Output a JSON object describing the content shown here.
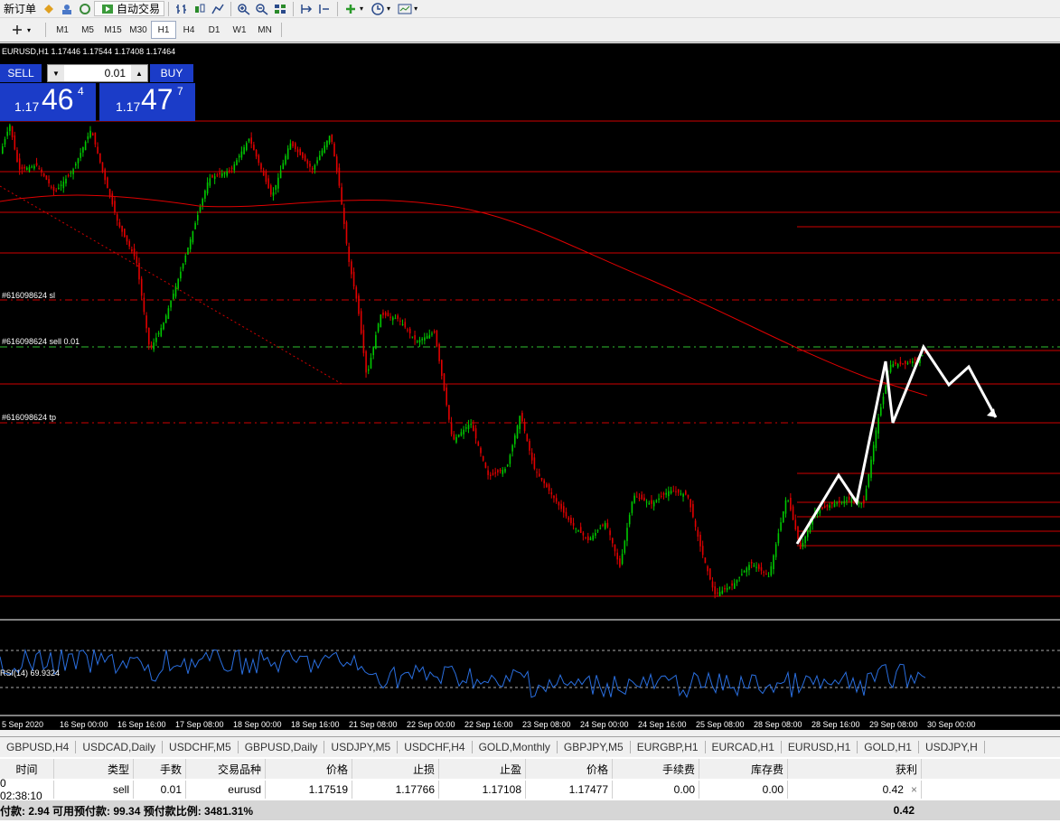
{
  "toolbar": {
    "new_order": "新订单",
    "auto_trading": "自动交易",
    "timeframes": [
      "M1",
      "M5",
      "M15",
      "M30",
      "H1",
      "H4",
      "D1",
      "W1",
      "MN"
    ],
    "active_timeframe": "H1"
  },
  "chart": {
    "symbol_line": "EURUSD,H1  1.17446 1.17544 1.17408 1.17464",
    "sell_label": "SELL",
    "buy_label": "BUY",
    "lot_value": "0.01",
    "sell_price": {
      "small": "1.17",
      "big": "46",
      "pip": "4"
    },
    "buy_price": {
      "small": "1.17",
      "big": "47",
      "pip": "7"
    },
    "sl_label": "#616098624 sl",
    "sell_order_label": "#616098624 sell 0.01",
    "tp_label": "#616098624 tp",
    "rsi_label": "RSI(14) 69.9324",
    "time_labels": [
      "5 Sep 2020",
      "16 Sep 00:00",
      "16 Sep 16:00",
      "17 Sep 08:00",
      "18 Sep 00:00",
      "18 Sep 16:00",
      "21 Sep 08:00",
      "22 Sep 00:00",
      "22 Sep 16:00",
      "23 Sep 08:00",
      "24 Sep 00:00",
      "24 Sep 16:00",
      "25 Sep 08:00",
      "28 Sep 08:00",
      "28 Sep 16:00",
      "29 Sep 08:00",
      "30 Sep 00:00"
    ],
    "colors": {
      "bull": "#00c800",
      "bear": "#e00000",
      "ma": "#e00000",
      "rsi": "#2a6fe0",
      "panel": "#1b3cc8"
    }
  },
  "tabs": [
    "GBPUSD,H4",
    "USDCAD,Daily",
    "USDCHF,M5",
    "GBPUSD,Daily",
    "USDJPY,M5",
    "USDCHF,H4",
    "GOLD,Monthly",
    "GBPJPY,M5",
    "EURGBP,H1",
    "EURCAD,H1",
    "EURUSD,H1",
    "GOLD,H1",
    "USDJPY,H"
  ],
  "terminal": {
    "headers": [
      "时间",
      "类型",
      "手数",
      "交易品种",
      "价格",
      "止损",
      "止盈",
      "价格",
      "手续费",
      "库存费",
      "获利"
    ],
    "row": [
      "0 02:38:10",
      "sell",
      "0.01",
      "eurusd",
      "1.17519",
      "1.17766",
      "1.17108",
      "1.17477",
      "0.00",
      "0.00",
      "0.42"
    ],
    "summary_text": "付款: 2.94  可用预付款: 99.34  预付款比例: 3481.31%",
    "summary_profit": "0.42"
  }
}
